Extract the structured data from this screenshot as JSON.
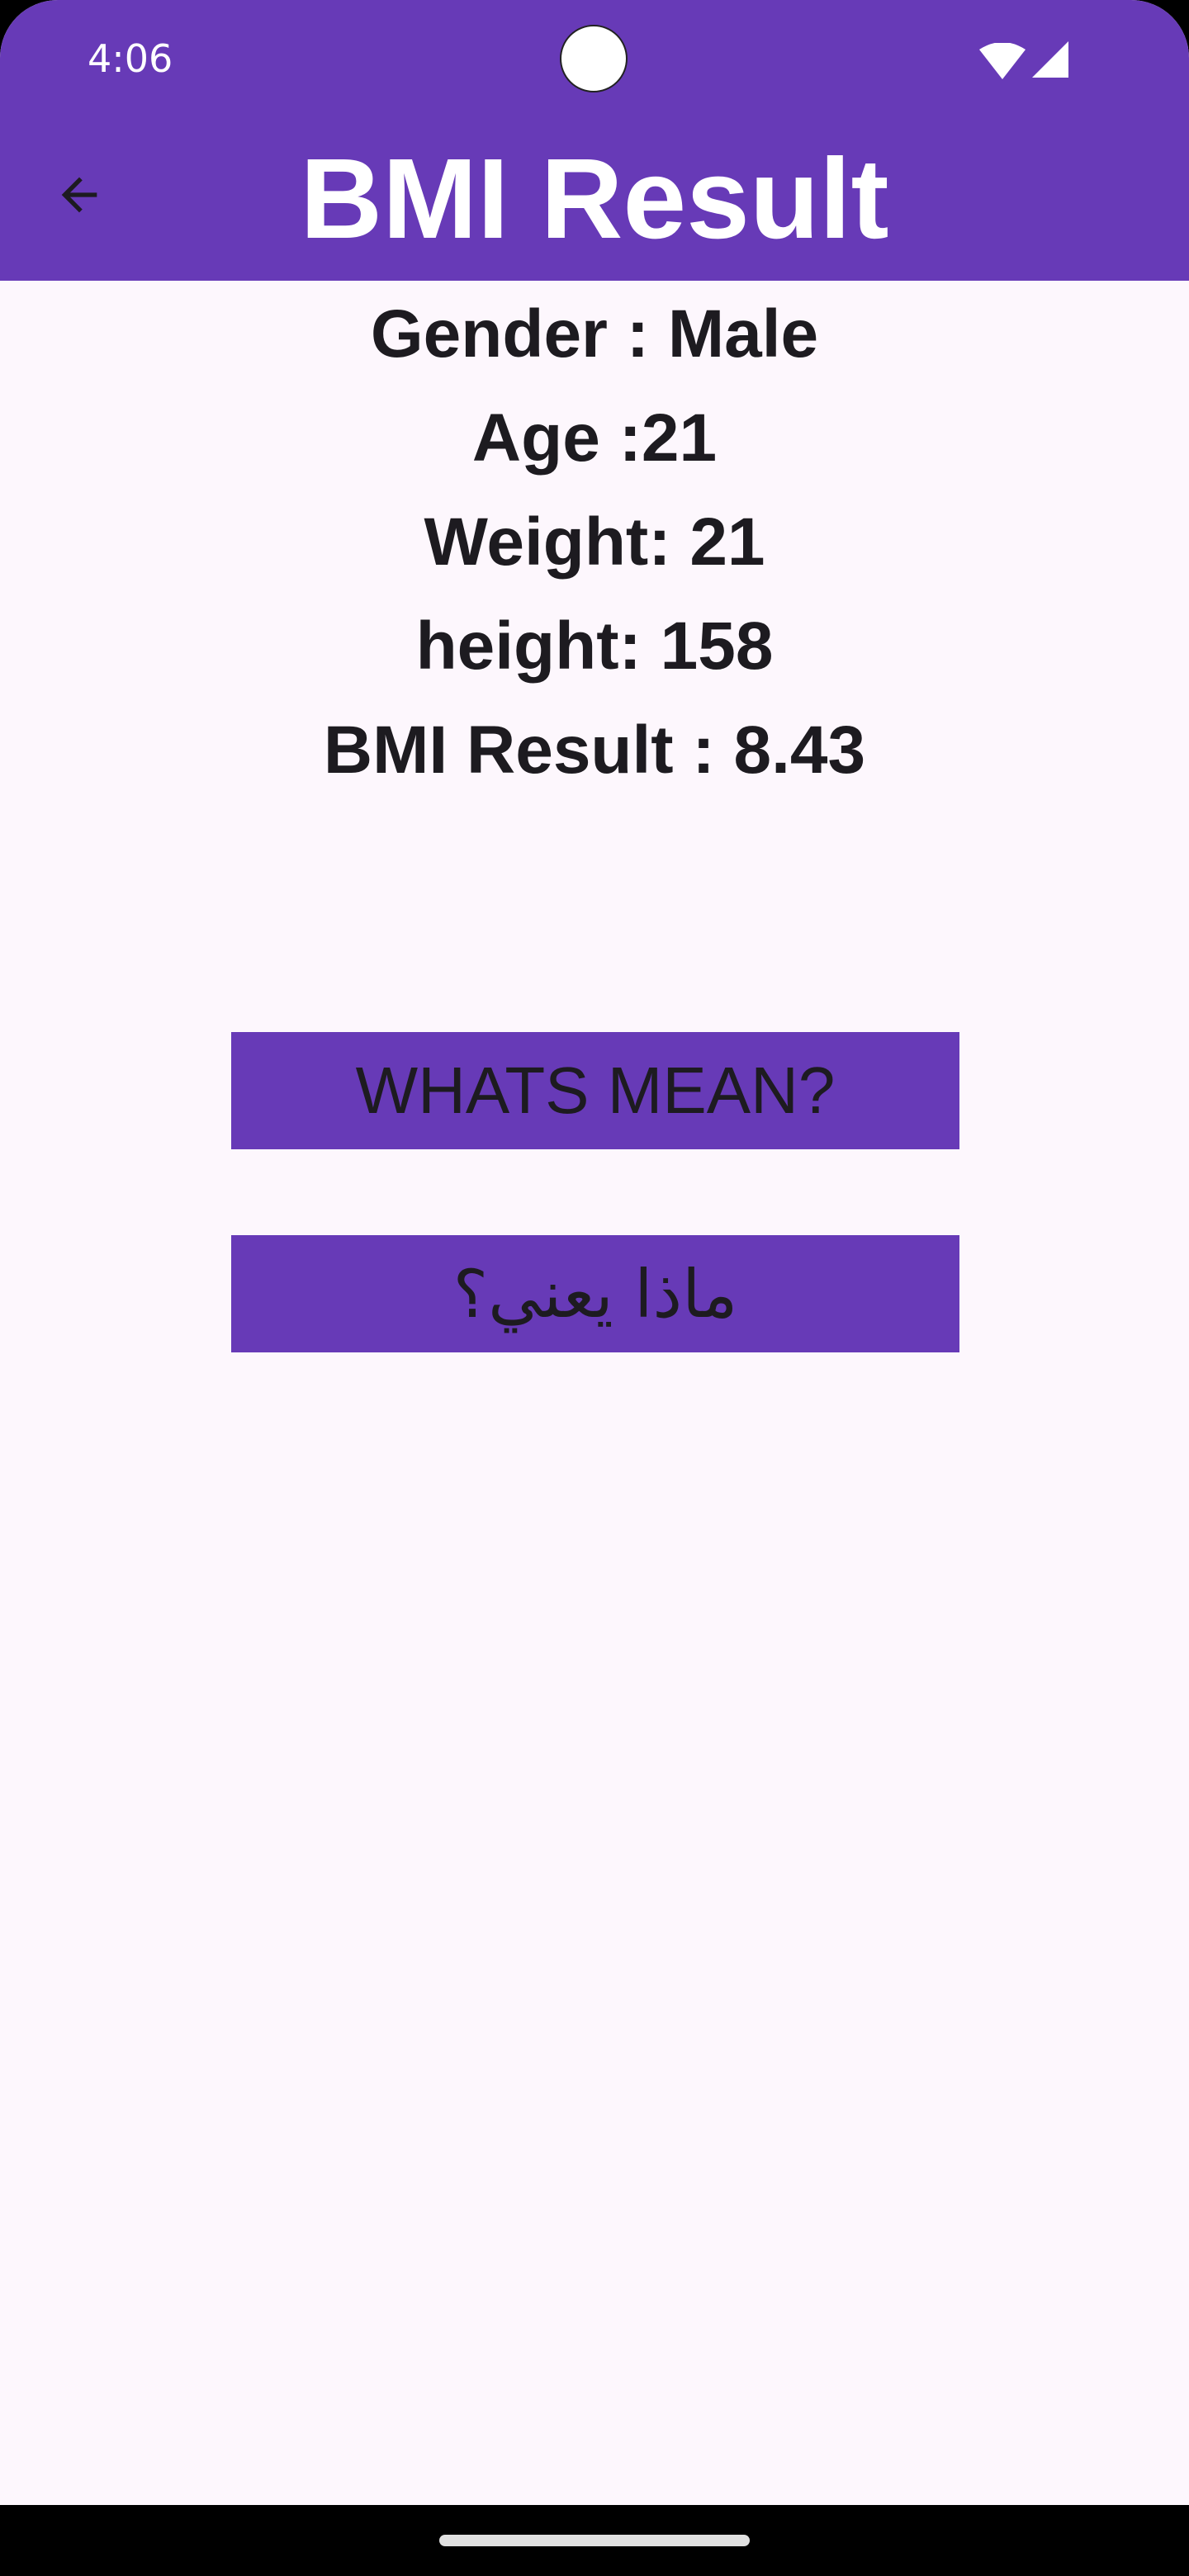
{
  "status_bar": {
    "time": "4:06",
    "icons": [
      "wifi-icon",
      "cellular-signal-icon"
    ]
  },
  "app_bar": {
    "title": "BMI Result",
    "back_icon": "arrow-back-icon"
  },
  "result": {
    "gender": "Gender : Male",
    "age": "Age :21",
    "weight": "Weight: 21",
    "height": "height: 158",
    "bmi": "BMI Result : 8.43"
  },
  "buttons": {
    "whats_mean": "WHATS MEAN?",
    "arabic": "ماذا يعني؟"
  },
  "colors": {
    "app_bar": "#673ab7",
    "background": "#fdf7fd",
    "button": "#673ab7",
    "text": "#1d1b20"
  }
}
